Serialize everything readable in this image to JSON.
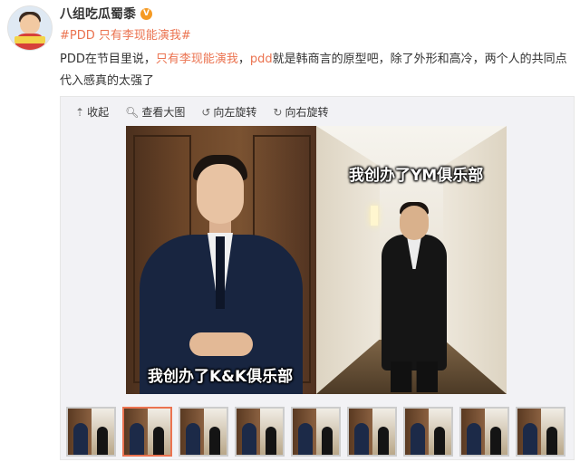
{
  "user": {
    "name": "八组吃瓜蜀黍",
    "verified_badge": "V"
  },
  "post": {
    "topic": "#PDD 只有李现能演我#",
    "text_part1": "PDD在节目里说，",
    "text_highlight1": "只有李现能演我",
    "text_part2": "，",
    "text_highlight2": "pdd",
    "text_part3": "就是韩商言的原型吧，除了外形和高冷，两个人的共同点代入感真的太强了"
  },
  "toolbar": {
    "collapse": "收起",
    "view_large": "查看大图",
    "rotate_left": "向左旋转",
    "rotate_right": "向右旋转"
  },
  "image": {
    "caption_left": "我创办了K&K俱乐部",
    "caption_right": "我创办了YM俱乐部"
  },
  "thumbnails": {
    "count": 9,
    "active_index": 1
  },
  "colors": {
    "accent": "#eb7350",
    "text": "#333333",
    "badge": "#f59a23"
  }
}
